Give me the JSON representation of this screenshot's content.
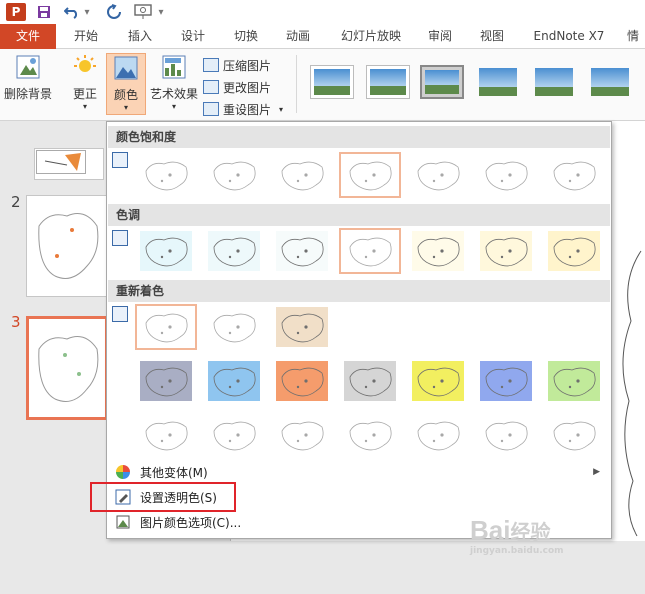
{
  "qat": {
    "app_logo": "P"
  },
  "tabs": [
    "文件",
    "开始",
    "插入",
    "设计",
    "切换",
    "动画",
    "幻灯片放映",
    "审阅",
    "视图",
    "EndNote X7",
    "情"
  ],
  "ribbon": {
    "remove_bg": "删除背景",
    "corrections": "更正",
    "color": "颜色",
    "artistic": "艺术效果",
    "compress": "压缩图片",
    "change": "更改图片",
    "reset": "重设图片"
  },
  "slides": [
    "2",
    "3"
  ],
  "dropdown": {
    "saturation_header": "颜色饱和度",
    "tone_header": "色调",
    "recolor_header": "重新着色",
    "more_variations": "其他变体(M)",
    "set_transparent": "设置透明色(S)",
    "picture_color_options": "图片颜色选项(C)...",
    "saturation_tints": [
      "#ffffff",
      "#ffffff",
      "#ffffff",
      "#ffffff",
      "#ffffff",
      "#ffffff",
      "#ffffff"
    ],
    "tone_tints": [
      "#e6f7fb",
      "#eef9fb",
      "#f6fbfb",
      "#ffffff",
      "#fffbe9",
      "#fff8dc",
      "#fff4cc"
    ],
    "recolor_row1": [
      "#ffffff",
      "#ffffff",
      "#f1dfc8"
    ],
    "recolor_row2": [
      "#a9aec4",
      "#8fc5ef",
      "#f59c6c",
      "#d5d5d5",
      "#f2ef60",
      "#90a8ee",
      "#c1ea9a"
    ],
    "recolor_row3": [
      "#ffffff",
      "#ffffff",
      "#ffffff",
      "#ffffff",
      "#ffffff",
      "#ffffff",
      "#ffffff"
    ]
  },
  "watermark": {
    "brand": "Bai",
    "brand2": "经验",
    "url": "jingyan.baidu.com"
  },
  "colors": {
    "accent": "#d24726",
    "highlight": "#e0242a",
    "selected_border": "#f2b697"
  }
}
